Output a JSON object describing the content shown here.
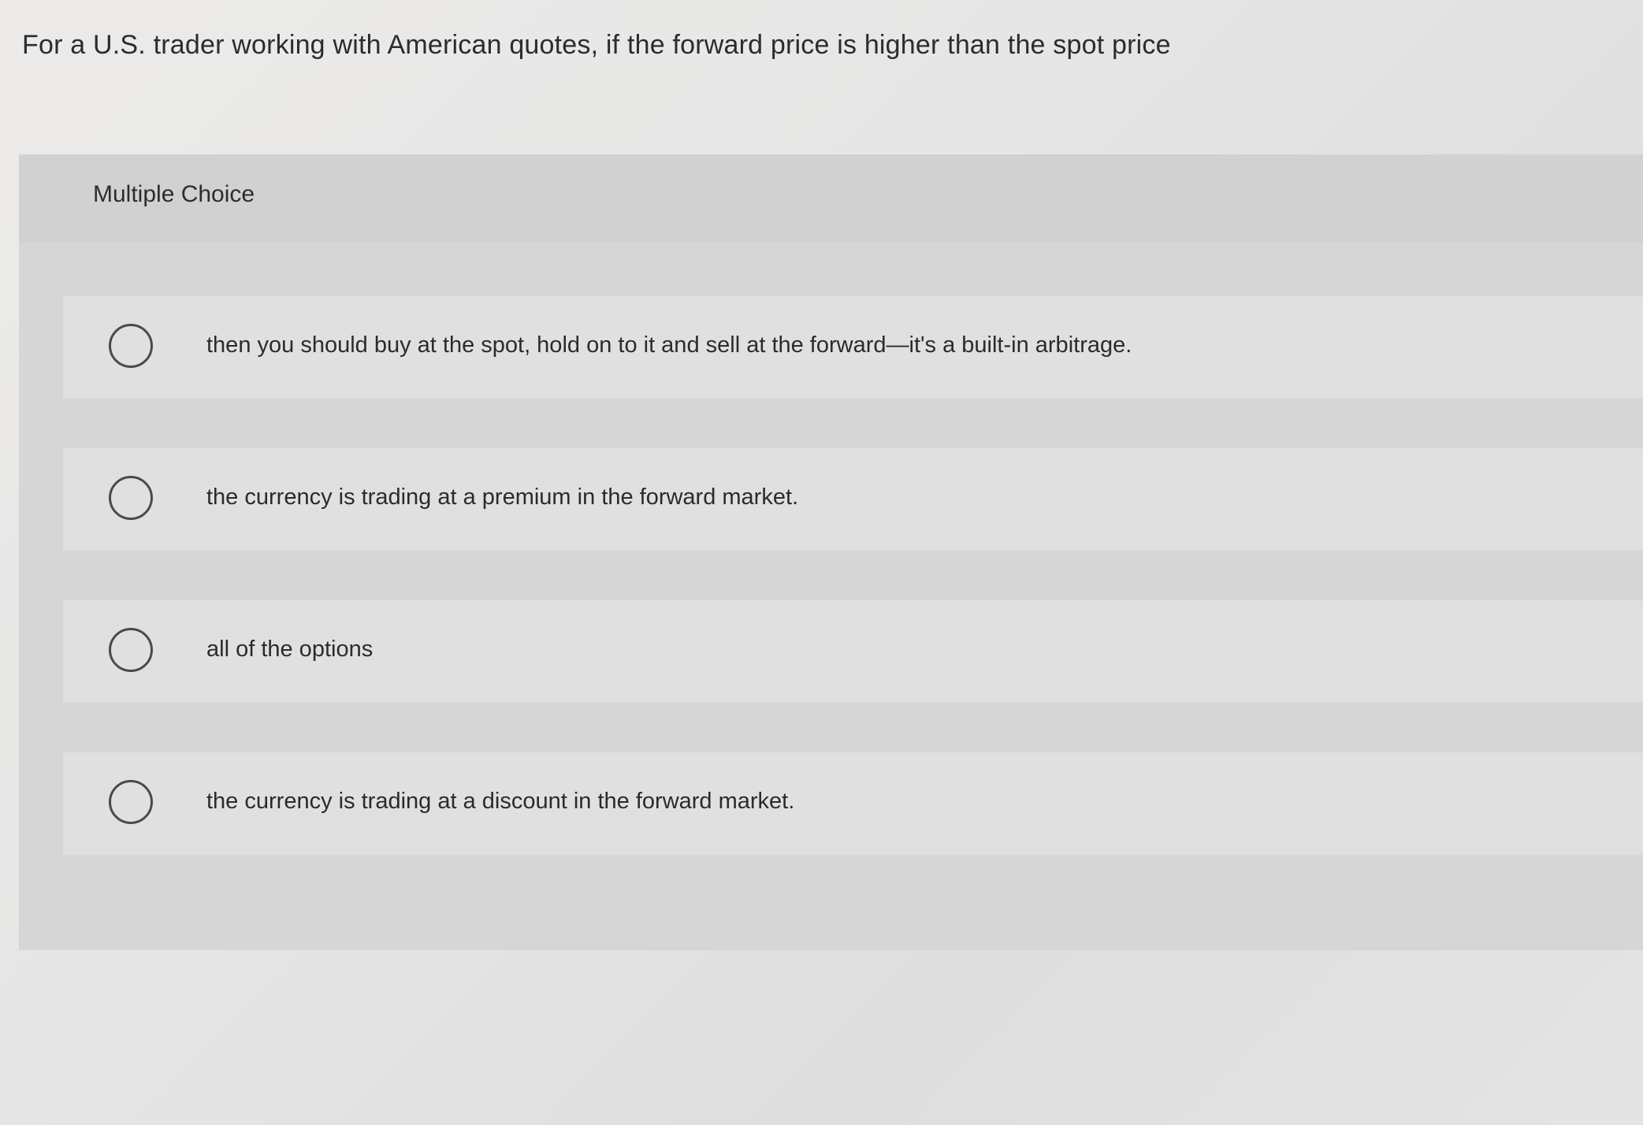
{
  "question": {
    "text": "For a U.S. trader working with American quotes, if the forward price is higher than the spot price"
  },
  "multiple_choice": {
    "label": "Multiple Choice",
    "options": [
      {
        "text": "then you should buy at the spot, hold on to it and sell at the forward—it's a built-in arbitrage."
      },
      {
        "text": "the currency is trading at a premium in the forward market."
      },
      {
        "text": "all of the options"
      },
      {
        "text": "the currency is trading at a discount in the forward market."
      }
    ]
  }
}
